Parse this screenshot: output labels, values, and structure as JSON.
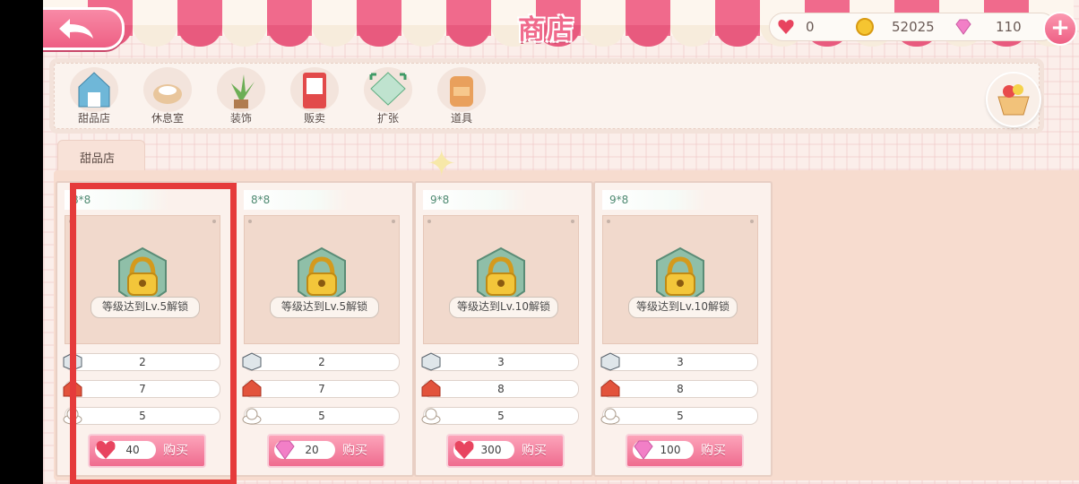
{
  "header": {
    "title": "商店",
    "currency": {
      "hearts": "0",
      "coins": "52025",
      "gems": "110"
    },
    "plus_label": "+"
  },
  "categories": [
    {
      "label": "甜品店",
      "icon": "dessert-shop-icon"
    },
    {
      "label": "休息室",
      "icon": "lounge-icon"
    },
    {
      "label": "装饰",
      "icon": "plant-decor-icon"
    },
    {
      "label": "贩卖",
      "icon": "vending-machine-icon"
    },
    {
      "label": "扩张",
      "icon": "expand-icon"
    },
    {
      "label": "道具",
      "icon": "backpack-icon"
    }
  ],
  "tab": {
    "label": "甜品店"
  },
  "cards": [
    {
      "size": "8*8",
      "unlock": "等级达到Lv.5解锁",
      "stats": [
        "2",
        "7",
        "5"
      ],
      "price": "40",
      "price_currency": "heart",
      "buy": "购买"
    },
    {
      "size": "8*8",
      "unlock": "等级达到Lv.5解锁",
      "stats": [
        "2",
        "7",
        "5"
      ],
      "price": "20",
      "price_currency": "gem",
      "buy": "购买"
    },
    {
      "size": "9*8",
      "unlock": "等级达到Lv.10解锁",
      "stats": [
        "3",
        "8",
        "5"
      ],
      "price": "300",
      "price_currency": "heart",
      "buy": "购买"
    },
    {
      "size": "9*8",
      "unlock": "等级达到Lv.10解锁",
      "stats": [
        "3",
        "8",
        "5"
      ],
      "price": "100",
      "price_currency": "gem",
      "buy": "购买"
    }
  ],
  "colors": {
    "accent": "#f06a8c",
    "highlight_frame": "#e53b3b",
    "panel": "#f7dccf"
  }
}
